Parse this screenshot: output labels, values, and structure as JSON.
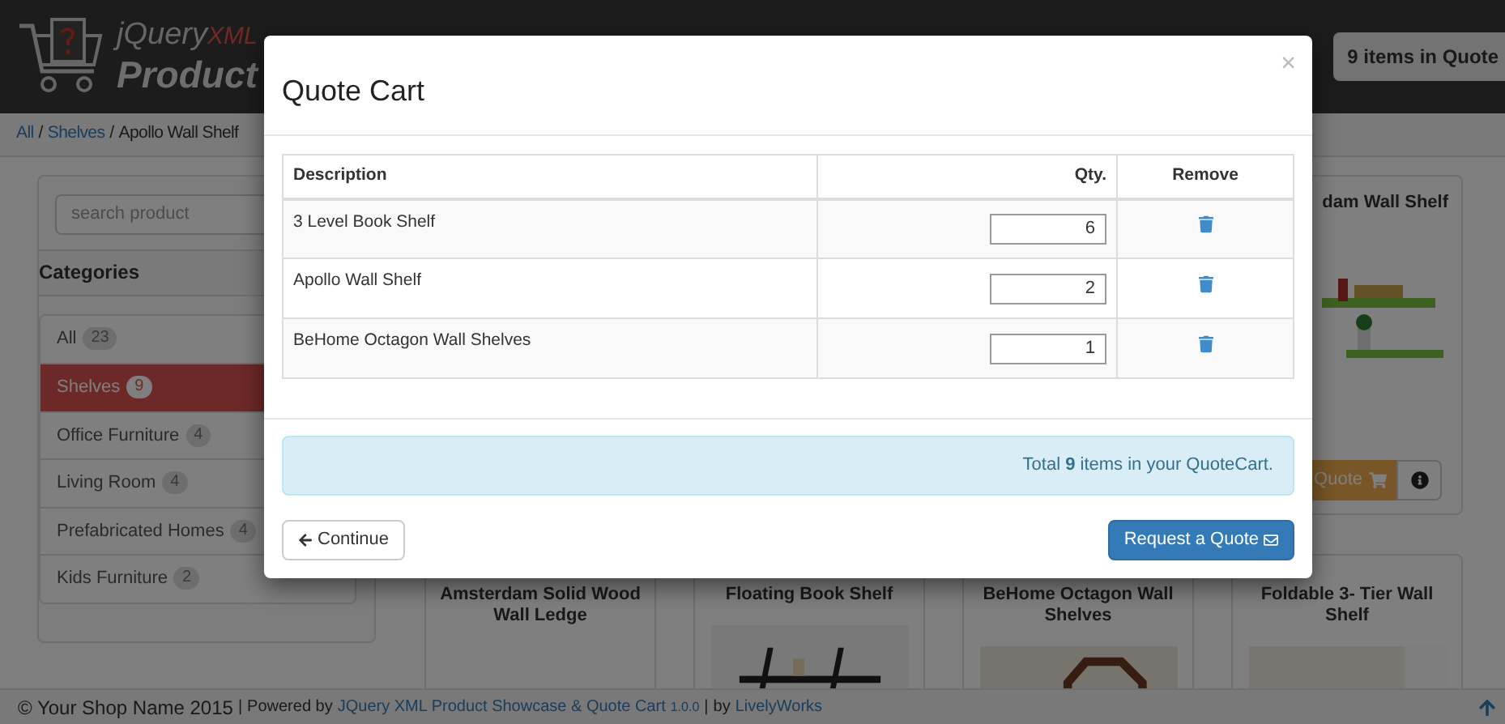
{
  "header": {
    "logo_top": "jQuery",
    "logo_accent": "XML",
    "logo_main": "Product",
    "cart_button": "9 items in Quote"
  },
  "breadcrumb": {
    "separator": "/",
    "items": [
      {
        "label": "All",
        "link": true
      },
      {
        "label": "Shelves",
        "link": true
      },
      {
        "label": "Apollo Wall Shelf",
        "link": false
      }
    ]
  },
  "sidebar": {
    "search": {
      "placeholder": "search product"
    },
    "heading": "Categories",
    "categories": [
      {
        "label": "All",
        "count": "23",
        "selected": false
      },
      {
        "label": "Shelves",
        "count": "9",
        "selected": true
      },
      {
        "label": "Office Furniture",
        "count": "4",
        "selected": false
      },
      {
        "label": "Living Room",
        "count": "4",
        "selected": false
      },
      {
        "label": "Prefabricated Homes",
        "count": "4",
        "selected": false
      },
      {
        "label": "Kids Furniture",
        "count": "2",
        "selected": false
      }
    ]
  },
  "products": [
    {
      "title": "dam Wall Shelf",
      "button": "Quote",
      "kind": "picture"
    },
    {
      "title": "Amsterdam Solid Wood Wall Ledge"
    },
    {
      "title": "Floating Book Shelf",
      "kind": "picture"
    },
    {
      "title": "BeHome Octagon Wall Shelves",
      "kind": "picture"
    },
    {
      "title": "Foldable 3- Tier Wall Shelf",
      "kind": "picture"
    }
  ],
  "modal": {
    "title": "Quote Cart",
    "close": "×",
    "columns": [
      "Description",
      "Qty.",
      "Remove"
    ],
    "rows": [
      {
        "description": "3 Level Book Shelf",
        "qty": "6"
      },
      {
        "description": "Apollo Wall Shelf",
        "qty": "2"
      },
      {
        "description": "BeHome Octagon Wall Shelves",
        "qty": "1"
      }
    ],
    "total": "Total **9** items in your QuoteCart.",
    "continue": "Continue",
    "request": "Request a Quote"
  },
  "footer": {
    "shop": "© Your Shop Name 2015",
    "separators": [
      "|",
      "|"
    ],
    "powered": "Powered by",
    "product_link": "JQuery XML Product Showcase & Quote Cart",
    "version": "1.0.0",
    "by": "by",
    "author_link": "LivelyWorks"
  }
}
